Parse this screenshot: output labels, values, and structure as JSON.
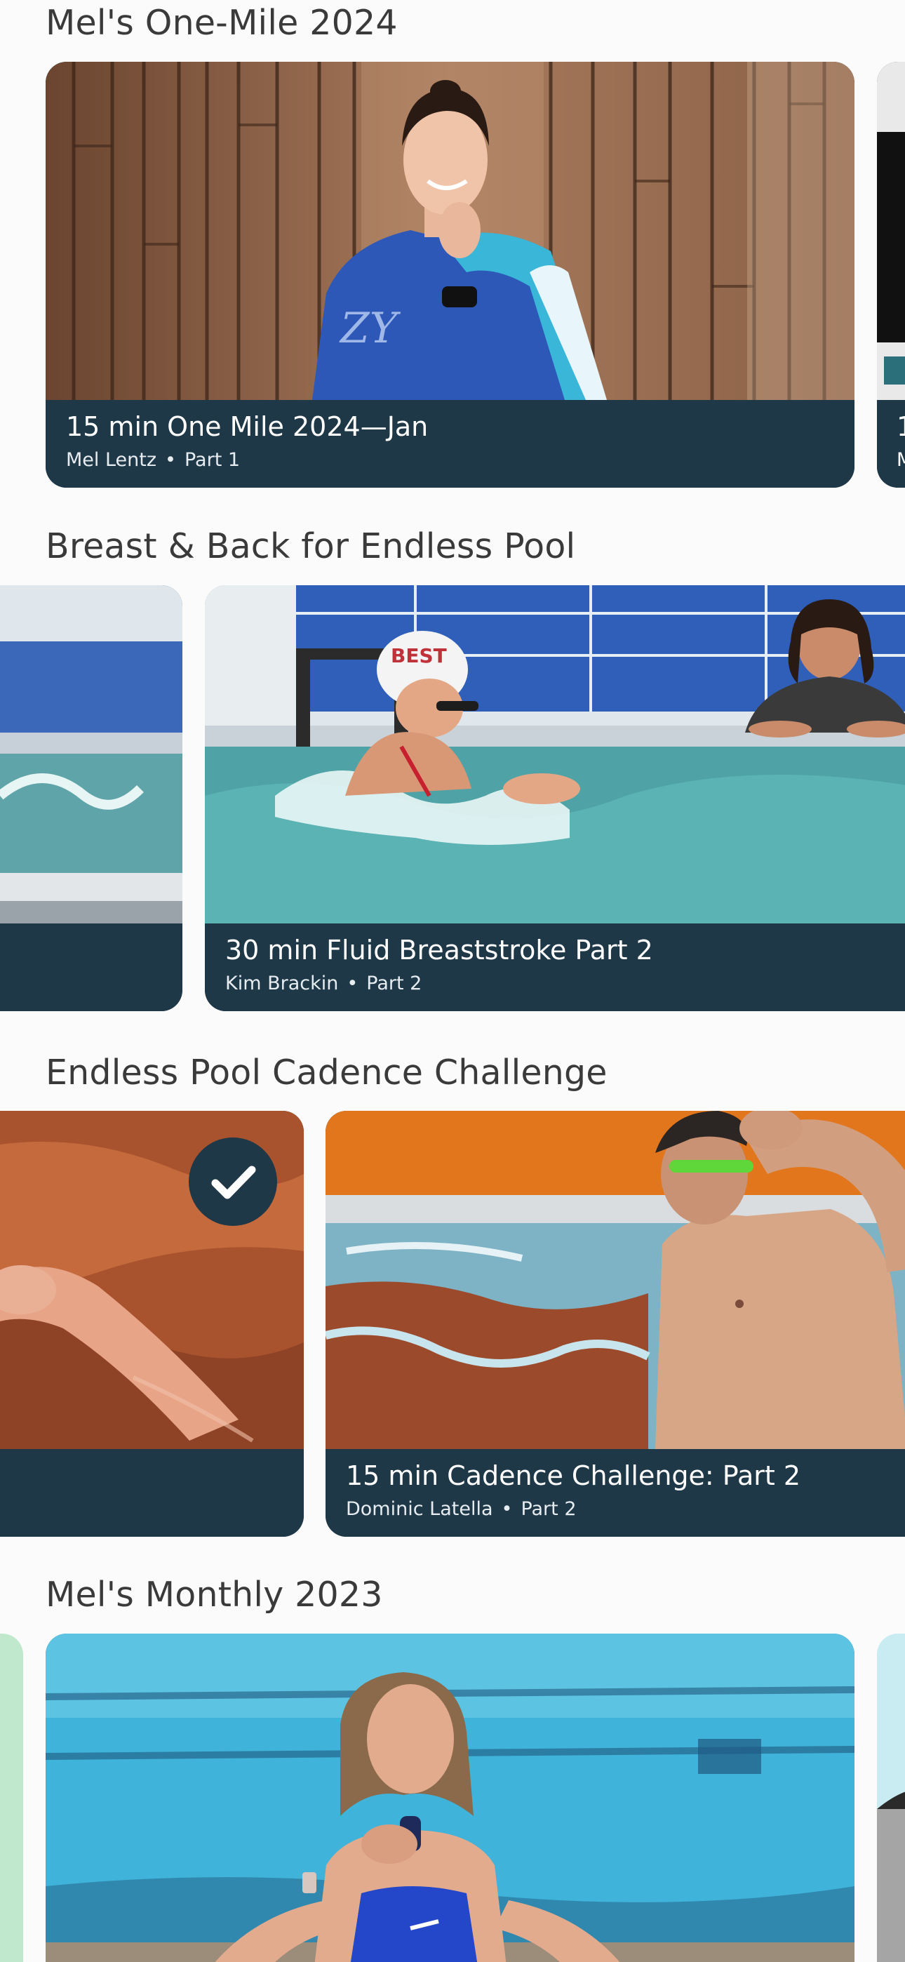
{
  "colors": {
    "background": "#fbfbfb",
    "card_footer": "#1e3848",
    "section_title": "#3a3a3a"
  },
  "sections": [
    {
      "title": "Mel's One-Mile 2024",
      "cards": [
        {
          "title": "15 min One Mile 2024—Jan",
          "coach": "Mel Lentz",
          "part": "Part 1",
          "image": "coach-with-towel-wood-wall-photo",
          "completed": false
        }
      ],
      "next_card_peek": {
        "title_initial": "1",
        "meta_initial": "M"
      }
    },
    {
      "title": "Breast & Back for Endless Pool",
      "cards": [
        {
          "title": "30 min Fluid Breaststroke Part 2",
          "coach": "Kim Brackin",
          "part": "Part 2",
          "image": "swimmer-breaststroke-endless-pool-photo",
          "completed": false
        }
      ]
    },
    {
      "title": "Endless Pool Cadence Challenge",
      "cards": [
        {
          "title": "15 min Cadence Challenge: Part 2",
          "coach": "Dominic Latella",
          "part": "Part 2",
          "image": "swimmer-adjusting-goggles-photo",
          "completed": false
        }
      ],
      "previous_card": {
        "completed": true,
        "icon": "checkmark-icon"
      }
    },
    {
      "title": "Mel's Monthly 2023",
      "cards": [
        {
          "image": "coach-at-pool-edge-photo"
        }
      ]
    }
  ]
}
